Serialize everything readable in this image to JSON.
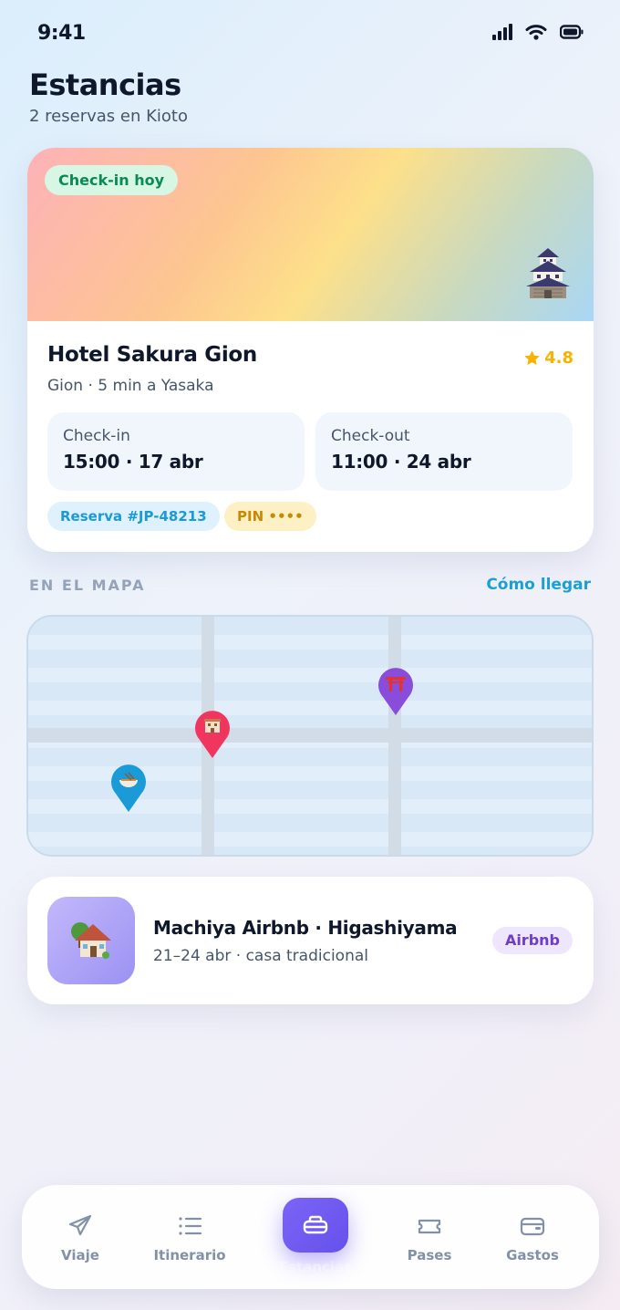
{
  "status_bar": {
    "time": "9:41",
    "icons": [
      "signal-icon",
      "wifi-icon",
      "battery-icon"
    ]
  },
  "header": {
    "title": "Estancias",
    "subtitle": "2 reservas en Kioto"
  },
  "hotel": {
    "badge": "Check-in hoy",
    "hero_icon": "castle-icon",
    "name": "Hotel Sakura Gion",
    "rating": "4.8",
    "location": "Gion · 5 min a Yasaka",
    "checkin_label": "Check-in",
    "checkin_value": "15:00 · 17 abr",
    "checkout_label": "Check-out",
    "checkout_value": "11:00 · 24 abr",
    "reservation": "Reserva #JP-48213",
    "pin": "PIN ••••"
  },
  "map_section": {
    "label": "EN EL MAPA",
    "link": "Cómo llegar",
    "pins": [
      {
        "name": "hotel-pin",
        "color": "#f0355f",
        "icon": "hotel-icon"
      },
      {
        "name": "shrine-pin",
        "color": "#8a4cdb",
        "icon": "torii-icon"
      },
      {
        "name": "food-pin",
        "color": "#1a9ad6",
        "icon": "ramen-icon"
      }
    ]
  },
  "airbnb": {
    "icon": "house-icon",
    "title": "Machiya Airbnb · Higashiyama",
    "subtitle": "21–24 abr · casa tradicional",
    "badge": "Airbnb"
  },
  "tabs": [
    {
      "label": "Viaje",
      "icon": "plane-icon",
      "active": false
    },
    {
      "label": "Itinerario",
      "icon": "list-icon",
      "active": false
    },
    {
      "label": "Estancias",
      "icon": "bed-icon",
      "active": true
    },
    {
      "label": "Pases",
      "icon": "ticket-icon",
      "active": false
    },
    {
      "label": "Gastos",
      "icon": "wallet-icon",
      "active": false
    }
  ],
  "colors": {
    "accent": "#6f58f0",
    "link": "#1aa0d6",
    "star": "#f5b400",
    "success": "#0a8a54"
  }
}
